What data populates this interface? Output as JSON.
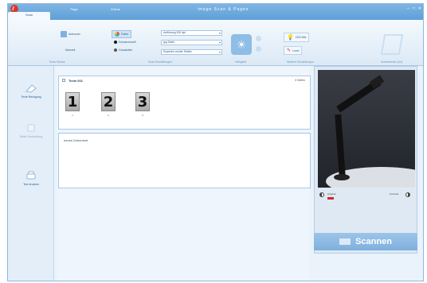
{
  "window": {
    "title": "image Scan & Pages"
  },
  "tabs": [
    {
      "label": "Scan"
    },
    {
      "label": "Page"
    },
    {
      "label": "Extras"
    }
  ],
  "active_tab": "Scan",
  "window_controls": {
    "minimize": "–",
    "maximize": "□",
    "close": "✕"
  },
  "ribbon": {
    "groups": [
      {
        "label": "Scan Modus"
      },
      {
        "label": "Scan Einstellungen"
      },
      {
        "label": "Helligkeit"
      },
      {
        "label": "Weitere Einstellungen"
      },
      {
        "label": "Scanbereich (A4)"
      }
    ],
    "scan_mode": {
      "auto_label": "Autoscan",
      "manual_label": "Manuell",
      "buttons": [
        "Autoscan",
        "Manuell"
      ],
      "sub": [
        "Manuell",
        "Auto Scan"
      ]
    },
    "scan_settings": {
      "color_label": "Farbe",
      "bw_label": "Schwarz/weiß",
      "gray_label": "Graustufen",
      "resolution": "Auflösung 300 dpi",
      "format": "jpg Datei",
      "sides": "Scannen vorder Seiten"
    },
    "more_settings": {
      "led_label": "LED Bits",
      "level_label": "Level"
    }
  },
  "left_nav": [
    {
      "label": "Texte Reinigung"
    },
    {
      "label": "Bilder Bearbeitung"
    },
    {
      "label": "Text drucken"
    }
  ],
  "documents": {
    "first": {
      "title": "Texte 001",
      "count": "3 Seiten",
      "pages": [
        "1",
        "2",
        "3"
      ]
    },
    "new_doc_label": "neues Dokument"
  },
  "preview": {
    "slider_left": "Original",
    "slider_right": "Kontrast"
  },
  "scan_button": "Scannen",
  "colors": {
    "accent": "#5d9fd8",
    "brand": "#d63a2f",
    "bar_red": "#cc2b2b"
  }
}
